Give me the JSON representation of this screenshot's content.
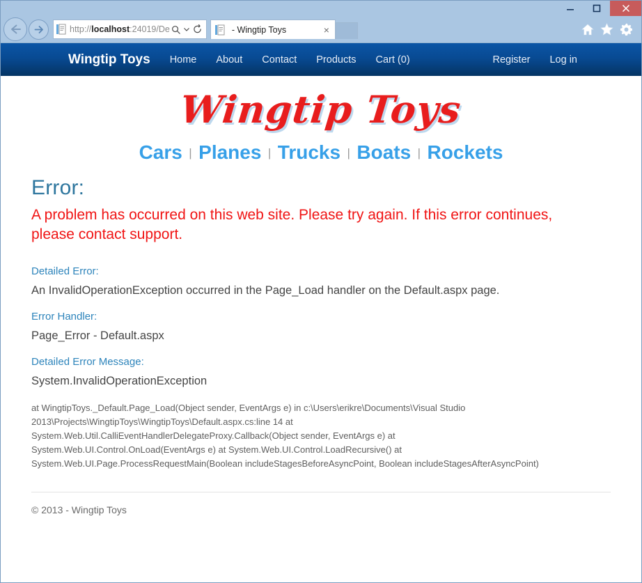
{
  "window": {
    "controls": [
      {
        "name": "minimize",
        "glyph": "minimize-icon"
      },
      {
        "name": "maximize",
        "glyph": "maximize-icon"
      },
      {
        "name": "close",
        "glyph": "close-icon"
      }
    ]
  },
  "browser": {
    "back_label": "Back",
    "forward_label": "Forward",
    "address": {
      "scheme": "http://",
      "host": "localhost",
      "path": ":24019/De",
      "full": "http://localhost:24019/De"
    },
    "address_icons": [
      "search-icon",
      "chevron-down-icon",
      "refresh-icon"
    ],
    "tab": {
      "title": "- Wingtip Toys",
      "close_glyph": "×"
    },
    "toolbar_icons": [
      "home-icon",
      "favorites-star-icon",
      "settings-gear-icon"
    ]
  },
  "site": {
    "navbar": {
      "brand": "Wingtip Toys",
      "links": [
        "Home",
        "About",
        "Contact",
        "Products",
        "Cart (0)"
      ],
      "right_links": [
        "Register",
        "Log in"
      ],
      "gradient_top": "#0b55a5",
      "gradient_bottom": "#043463"
    },
    "logo": "Wingtip Toys",
    "logo_color": "#e81d1d",
    "logo_shadow_color": "#bcd8ee",
    "categories": [
      "Cars",
      "Planes",
      "Trucks",
      "Boats",
      "Rockets"
    ],
    "category_color": "#37a0e8",
    "category_separator": "|"
  },
  "error_page": {
    "heading": "Error:",
    "heading_color": "#2e769e",
    "message": "A problem has occurred on this web site. Please try again. If this error continues, please contact support.",
    "message_color": "#f01414",
    "sections": [
      {
        "label": "Detailed Error:",
        "value": "An InvalidOperationException occurred in the Page_Load handler on the Default.aspx page."
      },
      {
        "label": "Error Handler:",
        "value": "Page_Error - Default.aspx"
      },
      {
        "label": "Detailed Error Message:",
        "value": "System.InvalidOperationException"
      }
    ],
    "stack_trace": "at WingtipToys._Default.Page_Load(Object sender, EventArgs e) in c:\\Users\\erikre\\Documents\\Visual Studio 2013\\Projects\\WingtipToys\\WingtipToys\\Default.aspx.cs:line 14 at System.Web.Util.CalliEventHandlerDelegateProxy.Callback(Object sender, EventArgs e) at System.Web.UI.Control.OnLoad(EventArgs e) at System.Web.UI.Control.LoadRecursive() at System.Web.UI.Page.ProcessRequestMain(Boolean includeStagesBeforeAsyncPoint, Boolean includeStagesAfterAsyncPoint)"
  },
  "footer": {
    "copyright": "© 2013 - Wingtip Toys"
  }
}
